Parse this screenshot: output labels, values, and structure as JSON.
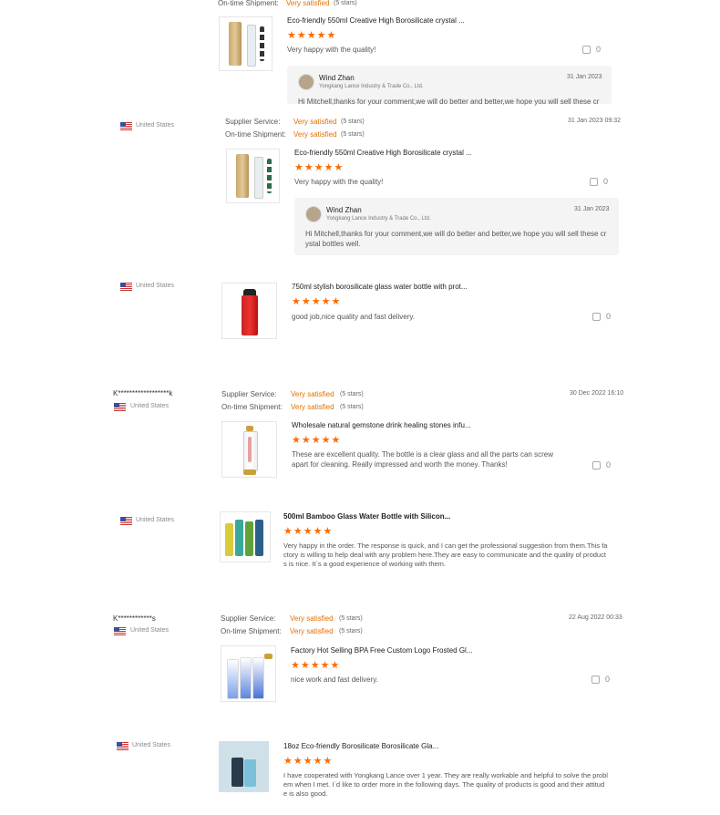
{
  "reviews": [
    {
      "country": "",
      "ontime_label": "On-time Shipment:",
      "ontime_value": "Very satisfied",
      "ontime_stars": "(5 stars)",
      "product_title": "Eco-friendly 550ml Creative High Borosilicate crystal ...",
      "rating": "★★★★★",
      "comment": "Very happy with the quality!",
      "likes": "0",
      "reply": {
        "name": "Wind Zhan",
        "company": "Yongkang Lance Industry & Trade Co., Ltd.",
        "date": "31 Jan 2023",
        "text": "Hi Mitchell,thanks for your comment,we will do better and better,we hope you will sell these cr"
      }
    },
    {
      "country": "United States",
      "supplier_label": "Supplier Service:",
      "supplier_value": "Very satisfied",
      "supplier_stars": "(5 stars)",
      "ontime_label": "On-time Shipment:",
      "ontime_value": "Very satisfied",
      "ontime_stars": "(5 stars)",
      "date": "31 Jan 2023 09:32",
      "product_title": "Eco-friendly 550ml Creative High Borosilicate crystal ...",
      "rating": "★★★★★",
      "comment": "Very happy with the quality!",
      "likes": "0",
      "reply": {
        "name": "Wind Zhan",
        "company": "Yongkang Lance Industry & Trade Co., Ltd.",
        "date": "31 Jan 2023",
        "text_line1": "Hi Mitchell,thanks for your comment,we will do better and better,we hope you will sell these cr",
        "text_line2": "ystal bottles well."
      }
    },
    {
      "country": "United States",
      "product_title": "750ml stylish borosilicate glass water bottle with prot...",
      "rating": "★★★★★",
      "comment": "good job,nice quality and fast delivery.",
      "likes": "0"
    },
    {
      "user": "K******************k",
      "country": "United States",
      "supplier_label": "Supplier Service:",
      "supplier_value": "Very satisfied",
      "supplier_stars": "(5 stars)",
      "ontime_label": "On-time Shipment:",
      "ontime_value": "Very satisfied",
      "ontime_stars": "(5 stars)",
      "date": "30 Dec 2022 16:10",
      "product_title": "Wholesale natural gemstone drink healing stones infu...",
      "rating": "★★★★★",
      "comment_line1": "These are excellent quality. The bottle is a clear glass and all the parts can screw",
      "comment_line2": "apart for cleaning. Really impressed and worth the money. Thanks!",
      "likes": "0"
    },
    {
      "country": "United States",
      "product_title": "500ml Bamboo Glass Water Bottle with Silicon...",
      "rating": "★★★★★",
      "comment_line1": "Very happy in the order. The response is quick, and I can get the professional suggestion from them.This fa",
      "comment_line2": "ctory is willing to help deal with any problem here.They are easy to communicate and the quality of product",
      "comment_line3": "s is nice. It`s a good experience of working with them."
    },
    {
      "user": "K************s",
      "country": "United States",
      "supplier_label": "Supplier Service:",
      "supplier_value": "Very satisfied",
      "supplier_stars": "(5 stars)",
      "ontime_label": "On-time Shipment:",
      "ontime_value": "Very satisfied",
      "ontime_stars": "(5 stars)",
      "date": "22 Aug 2022 00:33",
      "product_title": "Factory Hot Selling BPA Free Custom Logo Frosted Gl...",
      "rating": "★★★★★",
      "comment": "nice work and fast delivery.",
      "likes": "0"
    },
    {
      "country": "United States",
      "product_title": "18oz Eco-friendly Borosilicate Borosilicate Gla...",
      "rating": "★★★★★",
      "comment_line1": "I have cooperated with Yongkang Lance over 1 year. They are really workable and helpful to solve the probl",
      "comment_line2": "em when I met. I`d like to order more in the following days. The quality of products is good and their attitud",
      "comment_line3": "e is also good."
    }
  ],
  "colors": {
    "accent": "#ff6a00",
    "satisfied": "#e07000",
    "reply_bg": "#f4f4f4"
  }
}
